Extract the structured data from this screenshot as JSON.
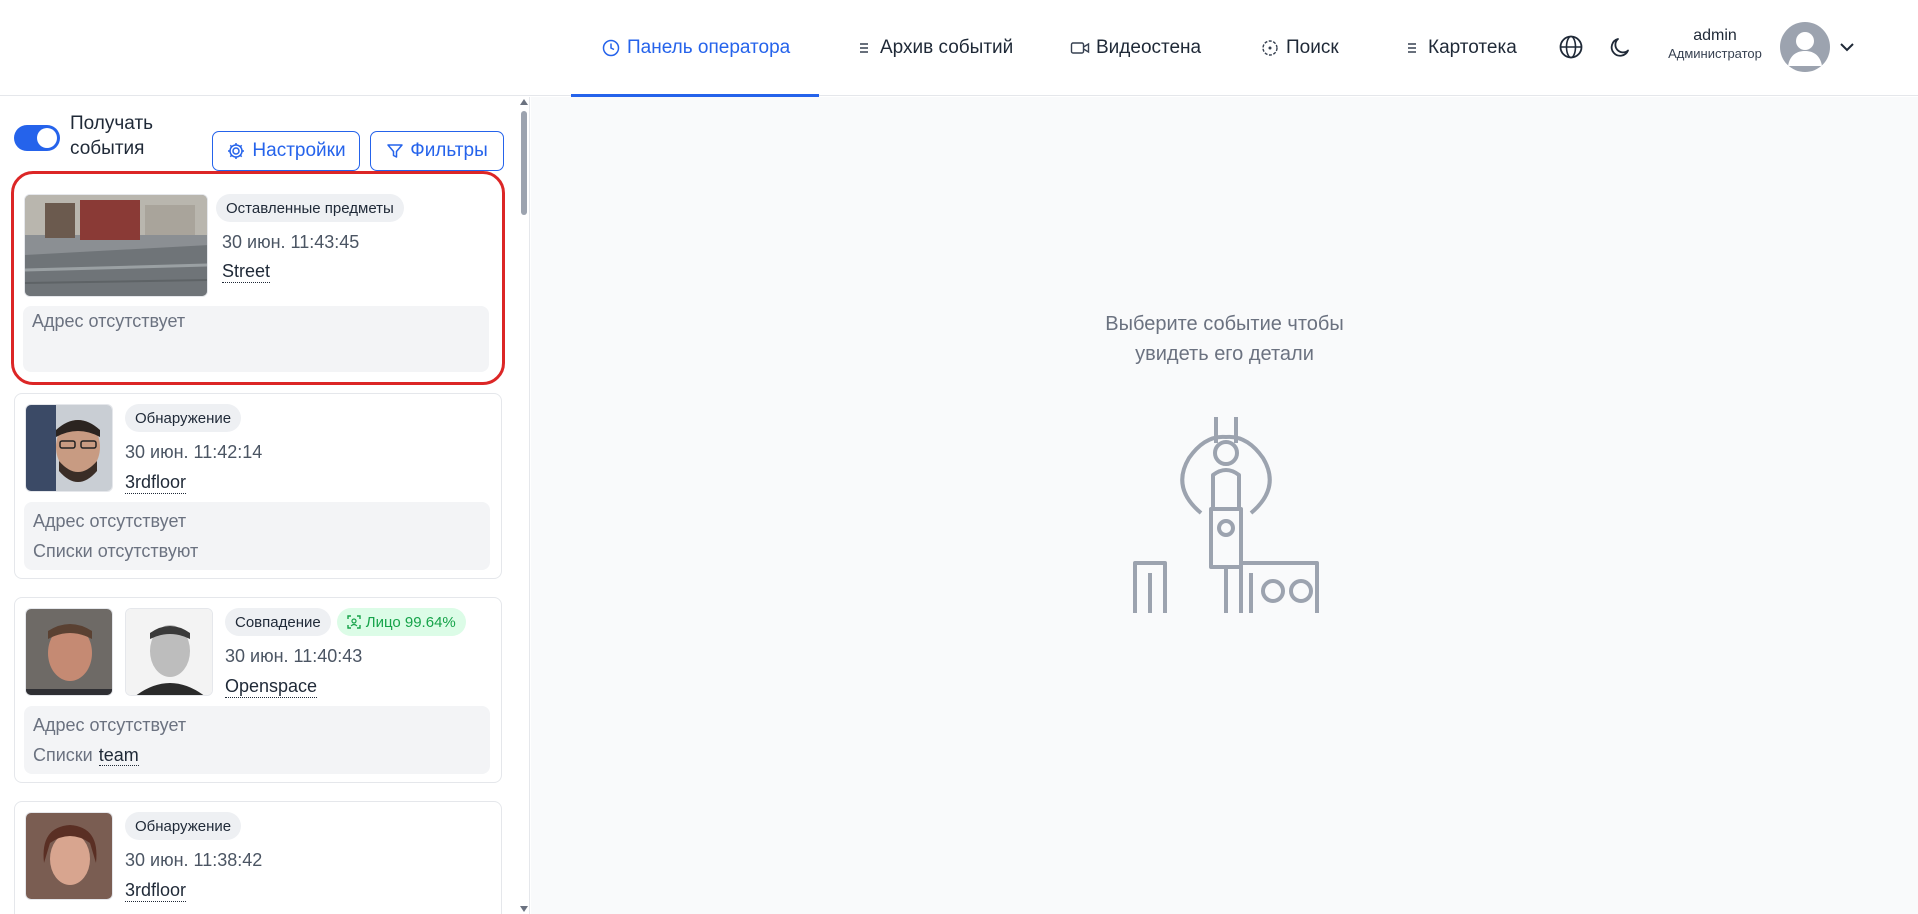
{
  "nav": {
    "operator_panel": "Панель оператора",
    "events_archive": "Архив событий",
    "video_wall": "Видеостена",
    "search": "Поиск",
    "card_index": "Картотека"
  },
  "user": {
    "name": "admin",
    "role": "Администратор"
  },
  "toolbar": {
    "receive_events": "Получать события",
    "receive_events_on": true,
    "settings": "Настройки",
    "filters": "Фильтры"
  },
  "events": [
    {
      "badge": "Оставленные предметы",
      "time": "30 июн. 11:43:45",
      "camera": "Street",
      "address": "Адрес отсутствует",
      "selected": true
    },
    {
      "badge": "Обнаружение",
      "time": "30 июн. 11:42:14",
      "camera": "3rdfloor",
      "address": "Адрес отсутствует",
      "lists": "Списки отсутствуют"
    },
    {
      "badge": "Совпадение",
      "match": "Лицо 99.64%",
      "time": "30 июн. 11:40:43",
      "camera": "Openspace",
      "address": "Адрес отсутствует",
      "lists_label": "Списки",
      "lists_value": "team"
    },
    {
      "badge": "Обнаружение",
      "time": "30 июн. 11:38:42",
      "camera": "3rdfloor"
    }
  ],
  "details": {
    "empty_line1": "Выберите событие чтобы",
    "empty_line2": "увидеть его детали"
  },
  "colors": {
    "accent": "#2563eb",
    "selected_border": "#dc2626",
    "match_green": "#16a34a"
  }
}
